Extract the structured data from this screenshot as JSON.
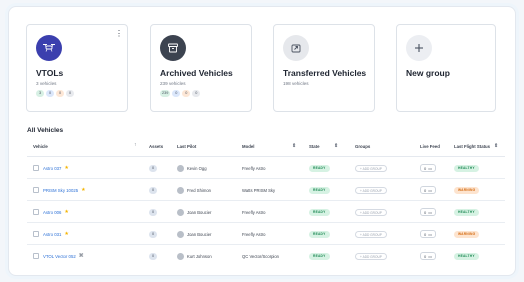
{
  "cards": [
    {
      "title": "VTOLs",
      "subtitle": "3 vehicles",
      "icon": "drone-icon",
      "badges": [
        "3",
        "0",
        "0",
        "0"
      ],
      "badge_colors": [
        "#d7f0e4",
        "#dbe7fb",
        "#fde7d6",
        "#e8eaee"
      ],
      "avatar_color": "#3b3fae"
    },
    {
      "title": "Archived Vehicles",
      "subtitle": "239 vehicles",
      "icon": "archive-icon",
      "badges": [
        "239",
        "0",
        "0",
        "0"
      ],
      "badge_colors": [
        "#d7f0e4",
        "#dbe7fb",
        "#fde7d6",
        "#e8eaee"
      ],
      "avatar_color": "#3c4350"
    },
    {
      "title": "Transferred Vehicles",
      "subtitle": "198 vehicles",
      "icon": "share-icon",
      "badges": [],
      "avatar_color": "#e6e8ec"
    },
    {
      "title": "New group",
      "icon": "plus-icon",
      "avatar_color": "#eceef2"
    }
  ],
  "table": {
    "title": "All Vehicles",
    "columns": [
      "Vehicle",
      "Assets",
      "Last Pilot",
      "Model",
      "State",
      "Groups",
      "Live Feed",
      "Last Flight Status"
    ],
    "rows": [
      {
        "vehicle": "Astro 037",
        "marker": "★",
        "assets": "0",
        "pilot": "Kevin Ogg",
        "model": "Freefly Astro",
        "state": "READY",
        "group": "+ ADD GROUP",
        "feed": "0",
        "status": "HEALTHY"
      },
      {
        "vehicle": "PRISM Sky 10025",
        "marker": "★",
        "assets": "0",
        "pilot": "Fred Shimon",
        "model": "Watts PRISM Sky",
        "state": "READY",
        "group": "+ ADD GROUP",
        "feed": "0",
        "status": "WARNING"
      },
      {
        "vehicle": "Astro 006",
        "marker": "★",
        "assets": "0",
        "pilot": "Joan Boucier",
        "model": "Freefly Astro",
        "state": "READY",
        "group": "+ ADD GROUP",
        "feed": "0",
        "status": "HEALTHY"
      },
      {
        "vehicle": "Astro 031",
        "marker": "★",
        "assets": "0",
        "pilot": "Joan Boucier",
        "model": "Freefly Astro",
        "state": "READY",
        "group": "+ ADD GROUP",
        "feed": "0",
        "status": "WARNING"
      },
      {
        "vehicle": "VTOL Vector 052",
        "marker": "⌘",
        "assets": "0",
        "pilot": "Kurt Johnson",
        "model": "QC Vector/Scorpion",
        "state": "READY",
        "group": "+ ADD GROUP",
        "feed": "0",
        "status": "HEALTHY"
      }
    ]
  },
  "colors": {
    "link": "#2a6fd6",
    "ready_bg": "#d6f2e3",
    "ready_fg": "#1f8a55",
    "healthy_bg": "#d6f2e3",
    "healthy_fg": "#1f8a55",
    "warning_bg": "#fde4cf",
    "warning_fg": "#d46b12"
  }
}
